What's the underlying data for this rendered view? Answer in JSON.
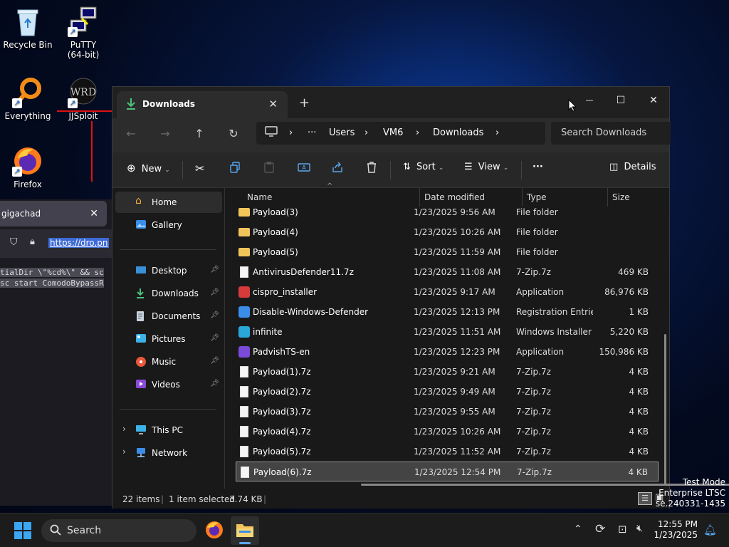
{
  "desktop": {
    "icons": [
      {
        "label": "Recycle Bin"
      },
      {
        "label": "PuTTY\n(64-bit)"
      },
      {
        "label": "Everything"
      },
      {
        "label": "JJSploit"
      },
      {
        "label": "Firefox"
      }
    ]
  },
  "background_browser": {
    "tab_title": "gigachad",
    "url": "https://dro.pn",
    "code_line1": "tialDir \\\"%cd%\\\" && sc",
    "code_line2": "sc start ComodoBypassR"
  },
  "explorer": {
    "tab_title": "Downloads",
    "new_tab": "+",
    "window_controls": {
      "minimize": "—",
      "maximize": "☐",
      "close": "✕"
    },
    "breadcrumb": {
      "more": "···",
      "segments": [
        "Users",
        "VM6",
        "Downloads"
      ]
    },
    "search_placeholder": "Search Downloads",
    "toolbar": {
      "new": "New",
      "sort": "Sort",
      "view": "View",
      "more": "···",
      "details": "Details"
    },
    "sidebar": {
      "home": "Home",
      "gallery": "Gallery",
      "desktop": "Desktop",
      "downloads": "Downloads",
      "documents": "Documents",
      "pictures": "Pictures",
      "music": "Music",
      "videos": "Videos",
      "this_pc": "This PC",
      "network": "Network"
    },
    "columns": {
      "name": "Name",
      "date": "Date modified",
      "type": "Type",
      "size": "Size"
    },
    "rows": [
      {
        "name": "Payload(3)",
        "date": "1/23/2025 9:56 AM",
        "type": "File folder",
        "size": "",
        "icon": "folder"
      },
      {
        "name": "Payload(4)",
        "date": "1/23/2025 10:26 AM",
        "type": "File folder",
        "size": "",
        "icon": "folder"
      },
      {
        "name": "Payload(5)",
        "date": "1/23/2025 11:59 AM",
        "type": "File folder",
        "size": "",
        "icon": "folder"
      },
      {
        "name": "AntivirusDefender11.7z",
        "date": "1/23/2025 11:08 AM",
        "type": "7-Zip.7z",
        "size": "469 KB",
        "icon": "file"
      },
      {
        "name": "cispro_installer",
        "date": "1/23/2025 9:17 AM",
        "type": "Application",
        "size": "86,976 KB",
        "icon": "app-red"
      },
      {
        "name": "Disable-Windows-Defender",
        "date": "1/23/2025 12:13 PM",
        "type": "Registration Entries",
        "size": "1 KB",
        "icon": "reg"
      },
      {
        "name": "infinite",
        "date": "1/23/2025 11:51 AM",
        "type": "Windows Installer ...",
        "size": "5,220 KB",
        "icon": "msi"
      },
      {
        "name": "PadvishTS-en",
        "date": "1/23/2025 12:23 PM",
        "type": "Application",
        "size": "150,986 KB",
        "icon": "app-purple"
      },
      {
        "name": "Payload(1).7z",
        "date": "1/23/2025 9:21 AM",
        "type": "7-Zip.7z",
        "size": "4 KB",
        "icon": "file"
      },
      {
        "name": "Payload(2).7z",
        "date": "1/23/2025 9:49 AM",
        "type": "7-Zip.7z",
        "size": "4 KB",
        "icon": "file"
      },
      {
        "name": "Payload(3).7z",
        "date": "1/23/2025 9:55 AM",
        "type": "7-Zip.7z",
        "size": "4 KB",
        "icon": "file"
      },
      {
        "name": "Payload(4).7z",
        "date": "1/23/2025 10:26 AM",
        "type": "7-Zip.7z",
        "size": "4 KB",
        "icon": "file"
      },
      {
        "name": "Payload(5).7z",
        "date": "1/23/2025 11:52 AM",
        "type": "7-Zip.7z",
        "size": "4 KB",
        "icon": "file"
      },
      {
        "name": "Payload(6).7z",
        "date": "1/23/2025 12:54 PM",
        "type": "7-Zip.7z",
        "size": "4 KB",
        "icon": "file",
        "selected": true
      }
    ],
    "status": {
      "items": "22 items",
      "selected": "1 item selected",
      "size": "3.74 KB"
    }
  },
  "watermark": {
    "line1": "Test Mode",
    "line2": "Enterprise LTSC",
    "line3": "se.240331-1435"
  },
  "taskbar": {
    "search_label": "Search",
    "time": "12:55 PM",
    "date": "1/23/2025"
  },
  "colors": {
    "accent": "#0078d4",
    "folder": "#f2c55c",
    "selection": "#444444"
  }
}
